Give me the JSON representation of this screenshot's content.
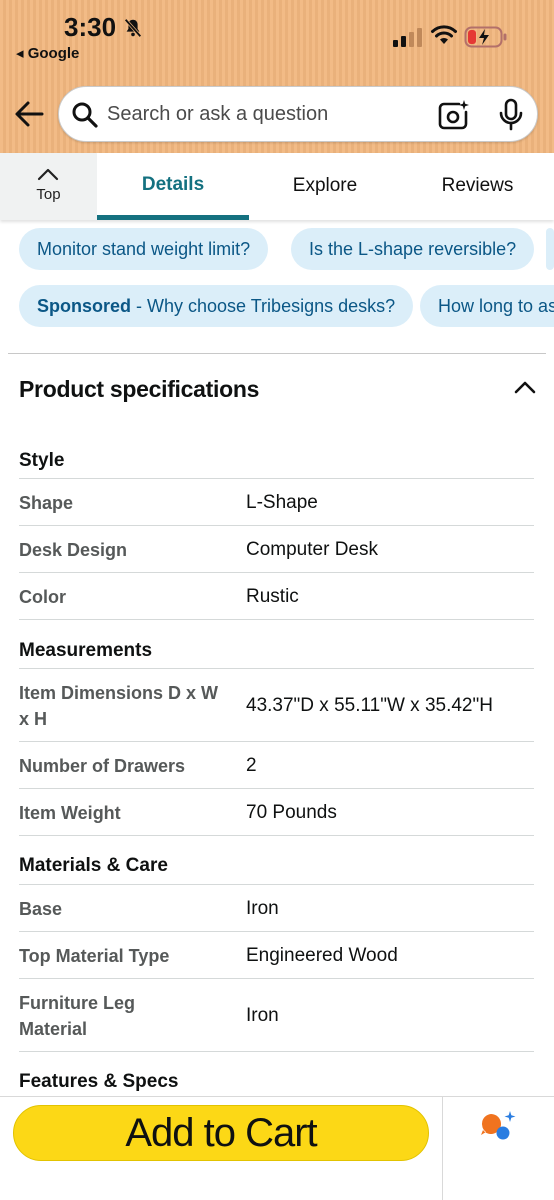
{
  "status_bar": {
    "time": "3:30",
    "back_app": "◂ Google"
  },
  "search": {
    "placeholder": "Search or ask a question"
  },
  "tabs": {
    "top_label": "Top",
    "items": [
      "Details",
      "Explore",
      "Reviews"
    ]
  },
  "chips": {
    "row1": [
      "Monitor stand weight limit?",
      "Is the L-shape reversible?"
    ],
    "row2_sponsored_label": "Sponsored",
    "row2_sponsored_text": " - Why choose Tribesigns desks?",
    "row2_second": "How long to as"
  },
  "specs": {
    "title": "Product specifications",
    "sections": [
      {
        "heading": "Style",
        "rows": [
          {
            "key": "Shape",
            "value": "L-Shape"
          },
          {
            "key": "Desk Design",
            "value": "Computer Desk"
          },
          {
            "key": "Color",
            "value": "Rustic"
          }
        ]
      },
      {
        "heading": "Measurements",
        "rows": [
          {
            "key": "Item Dimensions D x W x H",
            "value": "43.37\"D x 55.11\"W x 35.42\"H"
          },
          {
            "key": "Number of Drawers",
            "value": "2"
          },
          {
            "key": "Item Weight",
            "value": "70 Pounds"
          }
        ]
      },
      {
        "heading": "Materials & Care",
        "rows": [
          {
            "key": "Base",
            "value": "Iron"
          },
          {
            "key": "Top Material Type",
            "value": "Engineered Wood"
          },
          {
            "key": "Furniture Leg Material",
            "value": "Iron"
          }
        ]
      },
      {
        "heading": "Features & Specs",
        "rows": []
      }
    ]
  },
  "bottom": {
    "add_to_cart": "Add to Cart"
  },
  "colors": {
    "header_bg": "#f1b77f",
    "tab_accent": "#147180",
    "chip_bg": "#dbeef9",
    "chip_text": "#0b5786",
    "cart_button": "#fcd816"
  }
}
